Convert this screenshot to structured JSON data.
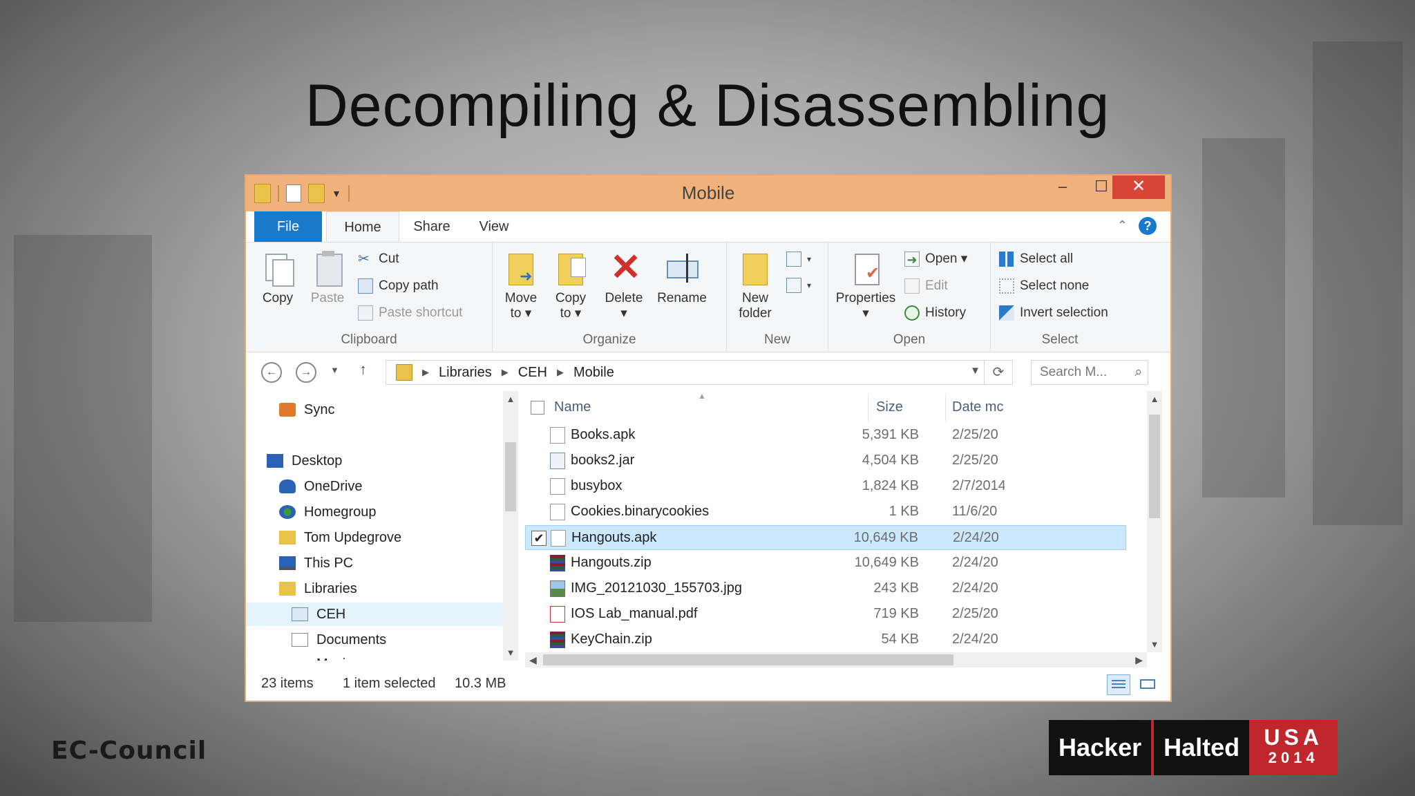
{
  "slide": {
    "title": "Decompiling & Disassembling"
  },
  "window": {
    "title": "Mobile",
    "controls": {
      "minimize": "–",
      "maximize": "☐",
      "close": "✕"
    }
  },
  "ribbon_tabs": [
    "File",
    "Home",
    "Share",
    "View"
  ],
  "ribbon": {
    "clipboard": {
      "label": "Clipboard",
      "copy": "Copy",
      "paste": "Paste",
      "cut": "Cut",
      "copy_path": "Copy path",
      "paste_shortcut": "Paste shortcut"
    },
    "organize": {
      "label": "Organize",
      "move_to": [
        "Move",
        "to ▾"
      ],
      "copy_to": [
        "Copy",
        "to ▾"
      ],
      "delete": [
        "Delete",
        "▾"
      ],
      "rename": "Rename"
    },
    "new": {
      "label": "New",
      "new_folder": [
        "New",
        "folder"
      ]
    },
    "open": {
      "label": "Open",
      "properties": [
        "Properties",
        "▾"
      ],
      "open": "Open ▾",
      "edit": "Edit",
      "history": "History"
    },
    "select": {
      "label": "Select",
      "select_all": "Select all",
      "select_none": "Select none",
      "invert_selection": "Invert selection"
    }
  },
  "address": {
    "breadcrumb": [
      "Libraries",
      "CEH",
      "Mobile"
    ],
    "search_placeholder": "Search M..."
  },
  "nav_pane": {
    "items": [
      {
        "label": "Sync",
        "icon": "sync-icon"
      },
      {
        "label": "Desktop",
        "icon": "desktop-icon"
      },
      {
        "label": "OneDrive",
        "icon": "onedrive-icon"
      },
      {
        "label": "Homegroup",
        "icon": "homegroup-icon"
      },
      {
        "label": "Tom Updegrove",
        "icon": "user-folder-icon"
      },
      {
        "label": "This PC",
        "icon": "pc-icon"
      },
      {
        "label": "Libraries",
        "icon": "libraries-icon"
      },
      {
        "label": "CEH",
        "icon": "library-icon"
      },
      {
        "label": "Documents",
        "icon": "documents-icon"
      },
      {
        "label": "Music",
        "icon": "music-icon"
      }
    ]
  },
  "file_list": {
    "columns": {
      "name": "Name",
      "size": "Size",
      "date": "Date mc"
    },
    "rows": [
      {
        "name": "Books.apk",
        "size": "5,391 KB",
        "date": "2/25/20",
        "icon": "file-icon",
        "selected": false
      },
      {
        "name": "books2.jar",
        "size": "4,504 KB",
        "date": "2/25/20",
        "icon": "jar-icon",
        "selected": false
      },
      {
        "name": "busybox",
        "size": "1,824 KB",
        "date": "2/7/2014",
        "icon": "file-icon",
        "selected": false
      },
      {
        "name": "Cookies.binarycookies",
        "size": "1 KB",
        "date": "11/6/20",
        "icon": "file-icon",
        "selected": false
      },
      {
        "name": "Hangouts.apk",
        "size": "10,649 KB",
        "date": "2/24/20",
        "icon": "file-icon",
        "selected": true
      },
      {
        "name": "Hangouts.zip",
        "size": "10,649 KB",
        "date": "2/24/20",
        "icon": "archive-icon",
        "selected": false
      },
      {
        "name": "IMG_20121030_155703.jpg",
        "size": "243 KB",
        "date": "2/24/20",
        "icon": "image-icon",
        "selected": false
      },
      {
        "name": "IOS Lab_manual.pdf",
        "size": "719 KB",
        "date": "2/25/20",
        "icon": "pdf-icon",
        "selected": false
      },
      {
        "name": "KeyChain.zip",
        "size": "54 KB",
        "date": "2/24/20",
        "icon": "archive-icon",
        "selected": false
      }
    ]
  },
  "status": {
    "items": "23 items",
    "selected": "1 item selected",
    "size": "10.3 MB"
  },
  "logos": {
    "ec_council": "EC-Council",
    "hacker": "Hacker",
    "halted": "Halted",
    "usa": "USA",
    "year": "2014"
  },
  "colors": {
    "accent": "#1979ca",
    "titlebar": "#f0b27a",
    "close": "#d84637",
    "selection": "#cce8ff",
    "brand_red": "#c0272d"
  }
}
